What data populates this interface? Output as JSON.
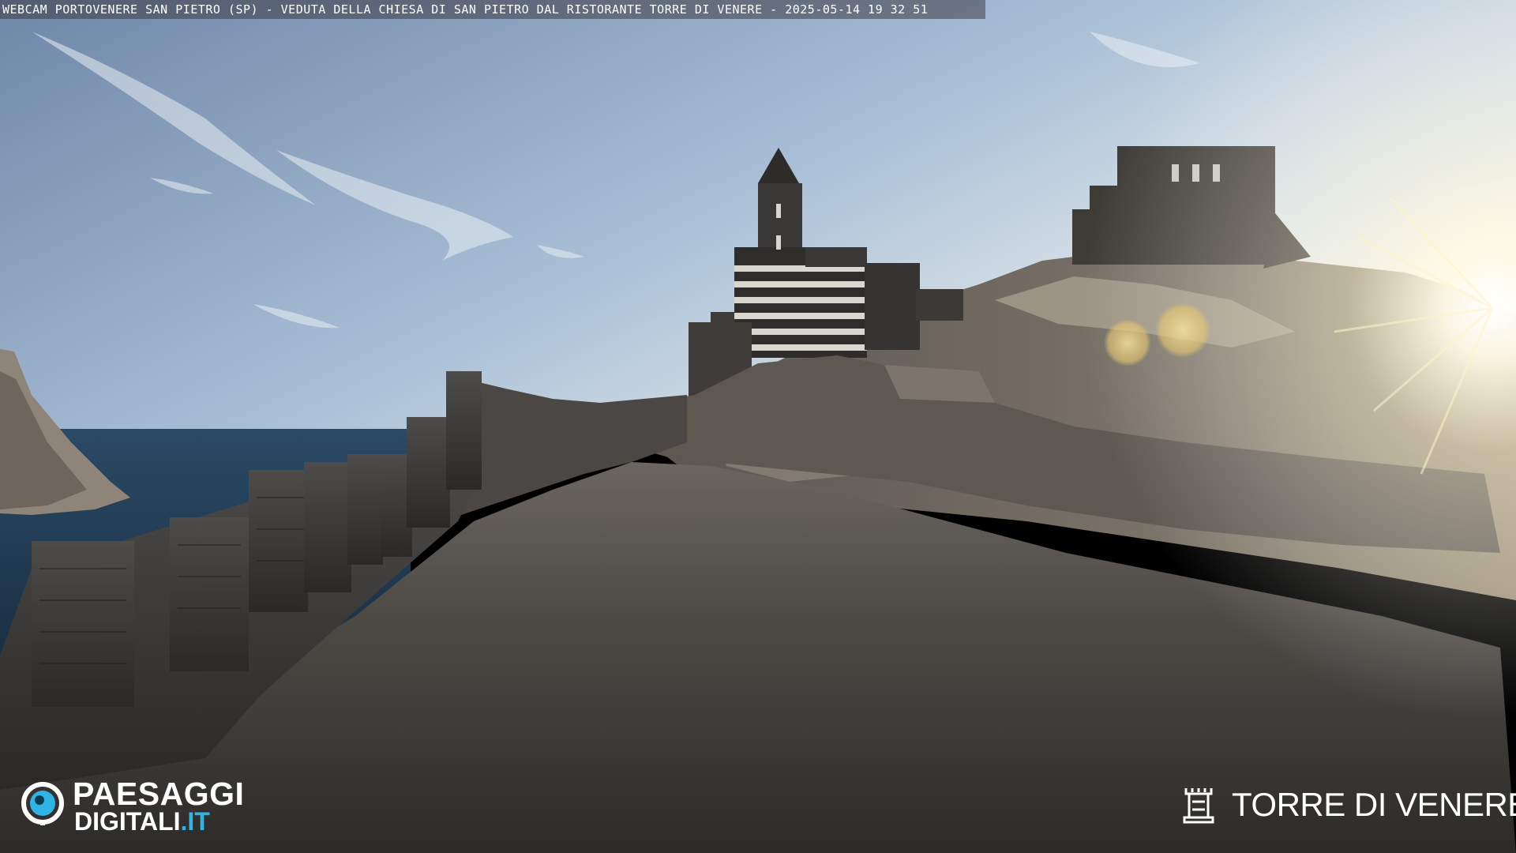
{
  "caption": {
    "text": "WEBCAM PORTOVENERE SAN PIETRO (SP) - VEDUTA DELLA CHIESA DI SAN PIETRO DAL RISTORANTE TORRE DI VENERE - 2025-05-14 19 32 51"
  },
  "logo_left": {
    "line1": "PAESAGGI",
    "line2_main": "DIGITALI",
    "line2_suffix": ".IT",
    "icon": "camera-eye-icon"
  },
  "logo_right": {
    "text": "TORRE DI VENERE",
    "icon": "tower-icon"
  },
  "colors": {
    "sky_top": "#6f87a8",
    "sky_bottom": "#dfe9f2",
    "sea": "#1f3a52",
    "accent": "#2fb4e6"
  }
}
